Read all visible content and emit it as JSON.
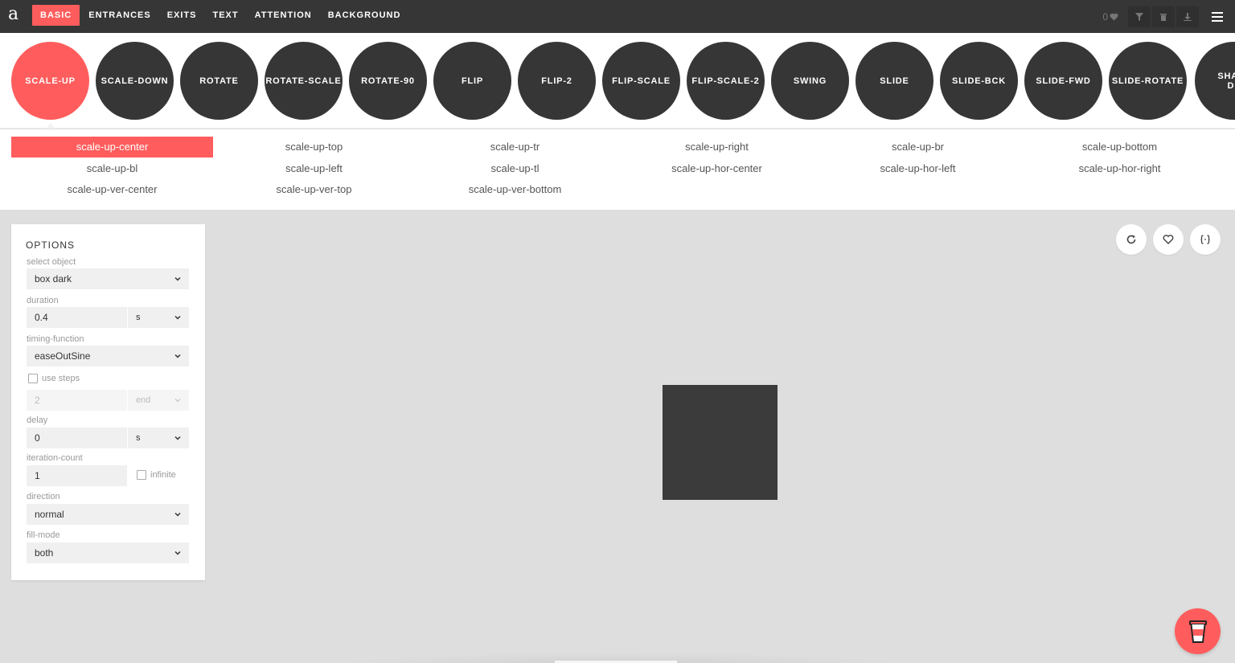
{
  "app": {
    "logo": "a"
  },
  "nav": {
    "tabs": [
      "BASIC",
      "ENTRANCES",
      "EXITS",
      "TEXT",
      "ATTENTION",
      "BACKGROUND"
    ],
    "active": "BASIC"
  },
  "top_right": {
    "favorites_count": "0"
  },
  "animations": [
    "SCALE-UP",
    "SCALE-DOWN",
    "ROTATE",
    "ROTATE-SCALE",
    "ROTATE-90",
    "FLIP",
    "FLIP-2",
    "FLIP-SCALE",
    "FLIP-SCALE-2",
    "SWING",
    "SLIDE",
    "SLIDE-BCK",
    "SLIDE-FWD",
    "SLIDE-ROTATE",
    "SHADOW-DROP"
  ],
  "active_animation": "SCALE-UP",
  "variants": [
    "scale-up-center",
    "scale-up-top",
    "scale-up-tr",
    "scale-up-right",
    "scale-up-br",
    "scale-up-bottom",
    "scale-up-bl",
    "scale-up-left",
    "scale-up-tl",
    "scale-up-hor-center",
    "scale-up-hor-left",
    "scale-up-hor-right",
    "scale-up-ver-center",
    "scale-up-ver-top",
    "scale-up-ver-bottom"
  ],
  "active_variant": "scale-up-center",
  "options": {
    "title": "OPTIONS",
    "select_object": {
      "label": "select object",
      "value": "box dark"
    },
    "duration": {
      "label": "duration",
      "value": "0.4",
      "unit": "s"
    },
    "timing_function": {
      "label": "timing-function",
      "value": "easeOutSine"
    },
    "use_steps": {
      "label": "use steps",
      "checked": false,
      "count": "2",
      "position": "end"
    },
    "delay": {
      "label": "delay",
      "value": "0",
      "unit": "s"
    },
    "iteration_count": {
      "label": "iteration-count",
      "value": "1",
      "infinite_label": "infinite",
      "infinite_checked": false
    },
    "direction": {
      "label": "direction",
      "value": "normal"
    },
    "fill_mode": {
      "label": "fill-mode",
      "value": "both"
    }
  },
  "colors": {
    "accent": "#ff5d5d",
    "dark": "#363636",
    "stage": "#dedede",
    "object": "#3b3b3b"
  },
  "icons": {
    "refresh": "refresh-icon",
    "favorite": "heart-icon",
    "code": "code-braces-icon",
    "coffee": "coffee-cup-icon"
  }
}
